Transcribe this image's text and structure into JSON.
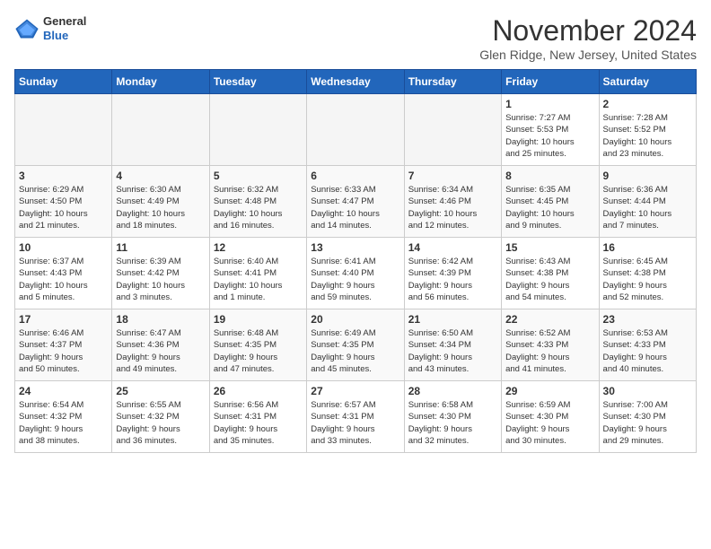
{
  "logo": {
    "general": "General",
    "blue": "Blue"
  },
  "title": "November 2024",
  "subtitle": "Glen Ridge, New Jersey, United States",
  "weekdays": [
    "Sunday",
    "Monday",
    "Tuesday",
    "Wednesday",
    "Thursday",
    "Friday",
    "Saturday"
  ],
  "weeks": [
    [
      {
        "day": "",
        "info": ""
      },
      {
        "day": "",
        "info": ""
      },
      {
        "day": "",
        "info": ""
      },
      {
        "day": "",
        "info": ""
      },
      {
        "day": "",
        "info": ""
      },
      {
        "day": "1",
        "info": "Sunrise: 7:27 AM\nSunset: 5:53 PM\nDaylight: 10 hours\nand 25 minutes."
      },
      {
        "day": "2",
        "info": "Sunrise: 7:28 AM\nSunset: 5:52 PM\nDaylight: 10 hours\nand 23 minutes."
      }
    ],
    [
      {
        "day": "3",
        "info": "Sunrise: 6:29 AM\nSunset: 4:50 PM\nDaylight: 10 hours\nand 21 minutes."
      },
      {
        "day": "4",
        "info": "Sunrise: 6:30 AM\nSunset: 4:49 PM\nDaylight: 10 hours\nand 18 minutes."
      },
      {
        "day": "5",
        "info": "Sunrise: 6:32 AM\nSunset: 4:48 PM\nDaylight: 10 hours\nand 16 minutes."
      },
      {
        "day": "6",
        "info": "Sunrise: 6:33 AM\nSunset: 4:47 PM\nDaylight: 10 hours\nand 14 minutes."
      },
      {
        "day": "7",
        "info": "Sunrise: 6:34 AM\nSunset: 4:46 PM\nDaylight: 10 hours\nand 12 minutes."
      },
      {
        "day": "8",
        "info": "Sunrise: 6:35 AM\nSunset: 4:45 PM\nDaylight: 10 hours\nand 9 minutes."
      },
      {
        "day": "9",
        "info": "Sunrise: 6:36 AM\nSunset: 4:44 PM\nDaylight: 10 hours\nand 7 minutes."
      }
    ],
    [
      {
        "day": "10",
        "info": "Sunrise: 6:37 AM\nSunset: 4:43 PM\nDaylight: 10 hours\nand 5 minutes."
      },
      {
        "day": "11",
        "info": "Sunrise: 6:39 AM\nSunset: 4:42 PM\nDaylight: 10 hours\nand 3 minutes."
      },
      {
        "day": "12",
        "info": "Sunrise: 6:40 AM\nSunset: 4:41 PM\nDaylight: 10 hours\nand 1 minute."
      },
      {
        "day": "13",
        "info": "Sunrise: 6:41 AM\nSunset: 4:40 PM\nDaylight: 9 hours\nand 59 minutes."
      },
      {
        "day": "14",
        "info": "Sunrise: 6:42 AM\nSunset: 4:39 PM\nDaylight: 9 hours\nand 56 minutes."
      },
      {
        "day": "15",
        "info": "Sunrise: 6:43 AM\nSunset: 4:38 PM\nDaylight: 9 hours\nand 54 minutes."
      },
      {
        "day": "16",
        "info": "Sunrise: 6:45 AM\nSunset: 4:38 PM\nDaylight: 9 hours\nand 52 minutes."
      }
    ],
    [
      {
        "day": "17",
        "info": "Sunrise: 6:46 AM\nSunset: 4:37 PM\nDaylight: 9 hours\nand 50 minutes."
      },
      {
        "day": "18",
        "info": "Sunrise: 6:47 AM\nSunset: 4:36 PM\nDaylight: 9 hours\nand 49 minutes."
      },
      {
        "day": "19",
        "info": "Sunrise: 6:48 AM\nSunset: 4:35 PM\nDaylight: 9 hours\nand 47 minutes."
      },
      {
        "day": "20",
        "info": "Sunrise: 6:49 AM\nSunset: 4:35 PM\nDaylight: 9 hours\nand 45 minutes."
      },
      {
        "day": "21",
        "info": "Sunrise: 6:50 AM\nSunset: 4:34 PM\nDaylight: 9 hours\nand 43 minutes."
      },
      {
        "day": "22",
        "info": "Sunrise: 6:52 AM\nSunset: 4:33 PM\nDaylight: 9 hours\nand 41 minutes."
      },
      {
        "day": "23",
        "info": "Sunrise: 6:53 AM\nSunset: 4:33 PM\nDaylight: 9 hours\nand 40 minutes."
      }
    ],
    [
      {
        "day": "24",
        "info": "Sunrise: 6:54 AM\nSunset: 4:32 PM\nDaylight: 9 hours\nand 38 minutes."
      },
      {
        "day": "25",
        "info": "Sunrise: 6:55 AM\nSunset: 4:32 PM\nDaylight: 9 hours\nand 36 minutes."
      },
      {
        "day": "26",
        "info": "Sunrise: 6:56 AM\nSunset: 4:31 PM\nDaylight: 9 hours\nand 35 minutes."
      },
      {
        "day": "27",
        "info": "Sunrise: 6:57 AM\nSunset: 4:31 PM\nDaylight: 9 hours\nand 33 minutes."
      },
      {
        "day": "28",
        "info": "Sunrise: 6:58 AM\nSunset: 4:30 PM\nDaylight: 9 hours\nand 32 minutes."
      },
      {
        "day": "29",
        "info": "Sunrise: 6:59 AM\nSunset: 4:30 PM\nDaylight: 9 hours\nand 30 minutes."
      },
      {
        "day": "30",
        "info": "Sunrise: 7:00 AM\nSunset: 4:30 PM\nDaylight: 9 hours\nand 29 minutes."
      }
    ]
  ]
}
